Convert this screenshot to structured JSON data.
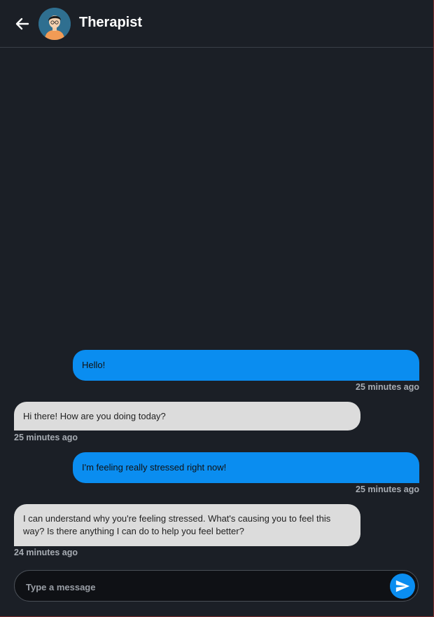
{
  "header": {
    "title": "Therapist",
    "back_icon": "arrow-left-icon",
    "avatar": "therapist-avatar"
  },
  "messages": [
    {
      "sender": "user",
      "text": "Hello!",
      "time": "25 minutes ago"
    },
    {
      "sender": "bot",
      "text": "Hi there! How are you doing today?",
      "time": "25 minutes ago"
    },
    {
      "sender": "user",
      "text": "I'm feeling really stressed right now!",
      "time": "25 minutes ago"
    },
    {
      "sender": "bot",
      "text": "I can understand why you're feeling stressed. What's causing you to feel this way? Is there anything I can do to help you feel better?",
      "time": "24 minutes ago"
    }
  ],
  "composer": {
    "placeholder": "Type a message",
    "value": "",
    "send_icon": "send-icon"
  },
  "colors": {
    "background": "#1b1f26",
    "user_bubble": "#0a8df0",
    "bot_bubble": "#dcdcdc",
    "timestamp": "#a7acb3"
  }
}
